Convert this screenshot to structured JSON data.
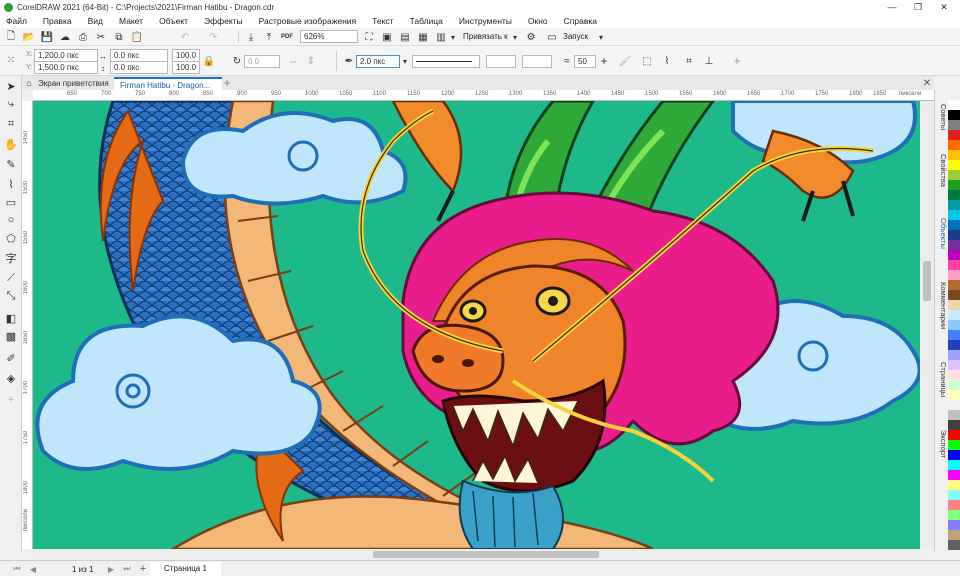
{
  "window": {
    "title": "CorelDRAW 2021 (64-Bit) - C:\\Projects\\2021\\Firman Hatibu - Dragon.cdr",
    "controls": [
      "—",
      "❐",
      "✕"
    ]
  },
  "menu": [
    "Файл",
    "Правка",
    "Вид",
    "Макет",
    "Объект",
    "Эффекты",
    "Растровые изображения",
    "Текст",
    "Таблица",
    "Инструменты",
    "Окно",
    "Справка"
  ],
  "standard_toolbar": {
    "zoom": "626%",
    "snap_label": "Привязать к",
    "launch_label": "Запуск"
  },
  "property_bar": {
    "x": "1,200.0 пкс",
    "y": "1,500.0 пкс",
    "w": "0.0 пкс",
    "h": "0.0 пкс",
    "scale_w": "100.0",
    "scale_h": "100.0",
    "angle": "0.0",
    "outline_width": "2.0 пкс",
    "miter": "50"
  },
  "tabs": [
    "Экран приветствия",
    "Firman Hatibu - Dragon..."
  ],
  "hruler": {
    "labels": [
      "650",
      "700",
      "750",
      "800",
      "850",
      "900",
      "950",
      "1000",
      "1050",
      "1100",
      "1150",
      "1200",
      "1250",
      "1300",
      "1350",
      "1400",
      "1450",
      "1500",
      "1550",
      "1600",
      "1650",
      "1700",
      "1750",
      "1800",
      "1850"
    ],
    "unit": "пиксели"
  },
  "vruler": {
    "labels": [
      "1450",
      "1500",
      "1550",
      "1600",
      "1650",
      "1700",
      "1750",
      "1800",
      "1850"
    ],
    "unit": "пиксели"
  },
  "dock_tabs": [
    "Советы",
    "Свойства",
    "Объекты",
    "Комментарии",
    "Страницы",
    "Экспорт"
  ],
  "palette": [
    "#ffffff",
    "#000000",
    "#7f7f7f",
    "#e02020",
    "#ff6a00",
    "#ffc000",
    "#ffff00",
    "#9ad03a",
    "#20a020",
    "#007a3d",
    "#00a0a0",
    "#00c8e8",
    "#0070c0",
    "#1f3c88",
    "#7030a0",
    "#c000c0",
    "#ff40a0",
    "#ff9cc8",
    "#b36a2a",
    "#7a4a20",
    "#e8d8a8",
    "#c8e8ff",
    "#88c8ff",
    "#4080ff",
    "#2040c0",
    "#a0a0ff",
    "#e0c0ff",
    "#ffe0e0",
    "#d0ffd0",
    "#ffffc0",
    "#f0f0f0",
    "#c0c0c0",
    "#404040",
    "#ff0000",
    "#00ff00",
    "#0000ff",
    "#00ffff",
    "#ff00ff",
    "#ffff80",
    "#80ffff",
    "#ff8080",
    "#80ff80",
    "#8080ff",
    "#c0a080",
    "#606060"
  ],
  "status": {
    "page_of": "1 из 1",
    "page_tab": "Страница 1"
  },
  "colors": {
    "canvas_bg": "#1eb98b",
    "accent": "#1a73c8"
  }
}
